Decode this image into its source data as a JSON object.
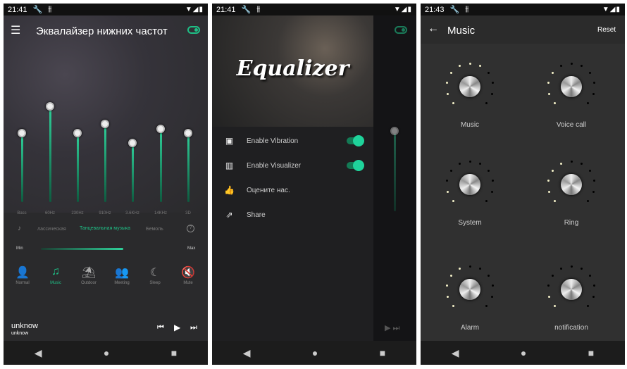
{
  "screen1": {
    "status": {
      "time": "21:41",
      "icons": "wrench-icon equalizer-icon wifi-icon signal-icon battery-icon"
    },
    "title": "Эквалайзер нижних частот",
    "enabled": true,
    "bands": [
      {
        "label": "Bass",
        "level_pct": 54
      },
      {
        "label": "60Hz",
        "level_pct": 75
      },
      {
        "label": "230Hz",
        "level_pct": 54
      },
      {
        "label": "910Hz",
        "level_pct": 61
      },
      {
        "label": "3.6KHz",
        "level_pct": 46
      },
      {
        "label": "14KHz",
        "level_pct": 57
      },
      {
        "label": "3D",
        "level_pct": 54
      }
    ],
    "presets": {
      "prev": "лассическая",
      "current": "Танцевальная музыка",
      "next": "Бемоль"
    },
    "volume": {
      "min_label": "Min",
      "max_label": "Max",
      "level_pct": 65
    },
    "modes": [
      {
        "label": "Normal",
        "icon": "person-icon",
        "glyph": "👤"
      },
      {
        "label": "Music",
        "icon": "music-note-icon",
        "glyph": "♫",
        "active": true
      },
      {
        "label": "Outdoor",
        "icon": "beach-icon",
        "glyph": "⛱"
      },
      {
        "label": "Meeting",
        "icon": "meeting-icon",
        "glyph": "👥"
      },
      {
        "label": "Sleep",
        "icon": "moon-icon",
        "glyph": "☾"
      },
      {
        "label": "Mute",
        "icon": "mute-icon",
        "glyph": "🔇"
      }
    ],
    "player": {
      "title": "unknow",
      "artist": "unknow"
    }
  },
  "screen2": {
    "status": {
      "time": "21:41"
    },
    "logo_text": "Equalizer",
    "items": [
      {
        "label": "Enable Vibration",
        "icon": "vibration-icon",
        "glyph": "▣",
        "toggle": true
      },
      {
        "label": "Enable Visualizer",
        "icon": "visualizer-icon",
        "glyph": "▥",
        "toggle": true
      },
      {
        "label": "Оцените нас.",
        "icon": "thumbs-up-icon",
        "glyph": "👍"
      },
      {
        "label": "Share",
        "icon": "share-icon",
        "glyph": "⇗"
      }
    ]
  },
  "screen3": {
    "status": {
      "time": "21:43"
    },
    "title": "Music",
    "reset_label": "Reset",
    "knobs": [
      {
        "label": "Music",
        "lit": 7
      },
      {
        "label": "Voice call",
        "lit": 4
      },
      {
        "label": "System",
        "lit": 2
      },
      {
        "label": "Ring",
        "lit": 5
      },
      {
        "label": "Alarm",
        "lit": 5
      },
      {
        "label": "notification",
        "lit": 2
      }
    ],
    "dots_total": 11
  },
  "colors": {
    "accent": "#1fbf86",
    "background": "#2a2a2c"
  }
}
